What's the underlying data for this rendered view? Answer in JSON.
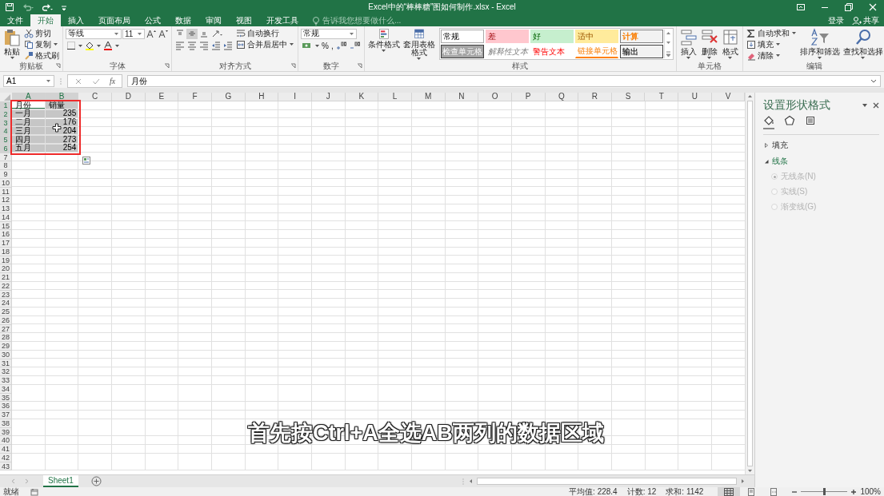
{
  "title_bar": {
    "title": "Excel中的“棒棒糖”图如何制作.xlsx - Excel",
    "sign_in": "登录",
    "share": "共享"
  },
  "ribbon_tabs": [
    {
      "label": "文件",
      "selected": false
    },
    {
      "label": "开始",
      "selected": true
    },
    {
      "label": "插入",
      "selected": false
    },
    {
      "label": "页面布局",
      "selected": false
    },
    {
      "label": "公式",
      "selected": false
    },
    {
      "label": "数据",
      "selected": false
    },
    {
      "label": "审阅",
      "selected": false
    },
    {
      "label": "视图",
      "selected": false
    },
    {
      "label": "开发工具",
      "selected": false
    }
  ],
  "tell_me": {
    "placeholder": "告诉我您想要做什么..."
  },
  "ribbon_groups": [
    {
      "kind": "clipboard",
      "label": "剪贴板",
      "launcher": true,
      "items": [
        "粘贴",
        "剪切",
        "复制",
        "格式刷"
      ]
    },
    {
      "kind": "font",
      "label": "字体",
      "launcher": true,
      "items": [
        "等线",
        "11"
      ]
    },
    {
      "kind": "alignment",
      "label": "对齐方式",
      "launcher": true,
      "items": [
        "自动换行",
        "合并后居中"
      ]
    },
    {
      "kind": "number",
      "label": "数字",
      "launcher": true,
      "items": [
        "常规",
        "%",
        ","
      ]
    },
    {
      "kind": "styles",
      "label": "样式",
      "launcher": false,
      "items": [
        "条件格式",
        "套用表格格式"
      ],
      "gallery": [
        {
          "label": "常规",
          "kind": "normal"
        },
        {
          "label": "差",
          "kind": "bad"
        },
        {
          "label": "好",
          "kind": "good"
        },
        {
          "label": "适中",
          "kind": "neutral"
        },
        {
          "label": "计算",
          "kind": "calc"
        },
        {
          "label": "检查单元格",
          "kind": "check"
        },
        {
          "label": "解释性文本",
          "kind": "explain"
        },
        {
          "label": "警告文本",
          "kind": "warn"
        },
        {
          "label": "链接单元格",
          "kind": "link"
        },
        {
          "label": "输出",
          "kind": "output"
        }
      ]
    },
    {
      "kind": "cells",
      "label": "单元格",
      "launcher": false,
      "items": [
        "插入",
        "删除",
        "格式"
      ]
    },
    {
      "kind": "editing",
      "label": "编辑",
      "launcher": false,
      "items": [
        "自动求和",
        "填充",
        "清除",
        "排序和筛选",
        "查找和选择"
      ]
    }
  ],
  "formula_bar": {
    "name_box": "A1",
    "function_button": "fx",
    "formula": "月份"
  },
  "sheet": {
    "columns": [
      {
        "label": "A",
        "selected": true
      },
      {
        "label": "B",
        "selected": true
      },
      {
        "label": "C",
        "selected": false
      },
      {
        "label": "D",
        "selected": false
      },
      {
        "label": "E",
        "selected": false
      },
      {
        "label": "F",
        "selected": false
      },
      {
        "label": "G",
        "selected": false
      },
      {
        "label": "H",
        "selected": false
      },
      {
        "label": "I",
        "selected": false
      },
      {
        "label": "J",
        "selected": false
      },
      {
        "label": "K",
        "selected": false
      },
      {
        "label": "L",
        "selected": false
      },
      {
        "label": "M",
        "selected": false
      },
      {
        "label": "N",
        "selected": false
      },
      {
        "label": "O",
        "selected": false
      },
      {
        "label": "P",
        "selected": false
      },
      {
        "label": "Q",
        "selected": false
      },
      {
        "label": "R",
        "selected": false
      },
      {
        "label": "S",
        "selected": false
      },
      {
        "label": "T",
        "selected": false
      },
      {
        "label": "U",
        "selected": false
      },
      {
        "label": "V",
        "selected": false
      }
    ],
    "row_headers": [
      {
        "label": "1",
        "selected": true
      },
      {
        "label": "2",
        "selected": true
      },
      {
        "label": "3",
        "selected": true
      },
      {
        "label": "4",
        "selected": true
      },
      {
        "label": "5",
        "selected": true
      },
      {
        "label": "6",
        "selected": true
      },
      {
        "label": "7",
        "selected": false
      },
      {
        "label": "8",
        "selected": false
      },
      {
        "label": "9",
        "selected": false
      },
      {
        "label": "10",
        "selected": false
      },
      {
        "label": "11",
        "selected": false
      },
      {
        "label": "12",
        "selected": false
      },
      {
        "label": "13",
        "selected": false
      },
      {
        "label": "14",
        "selected": false
      },
      {
        "label": "15",
        "selected": false
      },
      {
        "label": "16",
        "selected": false
      },
      {
        "label": "17",
        "selected": false
      },
      {
        "label": "18",
        "selected": false
      },
      {
        "label": "19",
        "selected": false
      },
      {
        "label": "20",
        "selected": false
      },
      {
        "label": "21",
        "selected": false
      },
      {
        "label": "22",
        "selected": false
      },
      {
        "label": "23",
        "selected": false
      },
      {
        "label": "24",
        "selected": false
      },
      {
        "label": "25",
        "selected": false
      },
      {
        "label": "26",
        "selected": false
      },
      {
        "label": "27",
        "selected": false
      },
      {
        "label": "28",
        "selected": false
      },
      {
        "label": "29",
        "selected": false
      },
      {
        "label": "30",
        "selected": false
      },
      {
        "label": "31",
        "selected": false
      },
      {
        "label": "32",
        "selected": false
      },
      {
        "label": "33",
        "selected": false
      },
      {
        "label": "34",
        "selected": false
      },
      {
        "label": "35",
        "selected": false
      },
      {
        "label": "36",
        "selected": false
      },
      {
        "label": "37",
        "selected": false
      },
      {
        "label": "38",
        "selected": false
      },
      {
        "label": "39",
        "selected": false
      },
      {
        "label": "40",
        "selected": false
      },
      {
        "label": "41",
        "selected": false
      },
      {
        "label": "42",
        "selected": false
      },
      {
        "label": "43",
        "selected": false
      }
    ],
    "rows": [
      [
        {
          "text": "月份",
          "kind": "text",
          "selected": true,
          "active": true
        },
        {
          "text": "销量",
          "kind": "text",
          "selected": true,
          "active": false
        }
      ],
      [
        {
          "text": "一月",
          "kind": "text",
          "selected": true,
          "active": false
        },
        {
          "text": "235",
          "kind": "number",
          "selected": true,
          "active": false
        }
      ],
      [
        {
          "text": "二月",
          "kind": "text",
          "selected": true,
          "active": false
        },
        {
          "text": "176",
          "kind": "number",
          "selected": true,
          "active": false
        }
      ],
      [
        {
          "text": "三月",
          "kind": "text",
          "selected": true,
          "active": false
        },
        {
          "text": "204",
          "kind": "number",
          "selected": true,
          "active": false
        }
      ],
      [
        {
          "text": "四月",
          "kind": "text",
          "selected": true,
          "active": false
        },
        {
          "text": "273",
          "kind": "number",
          "selected": true,
          "active": false
        }
      ],
      [
        {
          "text": "五月",
          "kind": "text",
          "selected": true,
          "active": false
        },
        {
          "text": "254",
          "kind": "number",
          "selected": true,
          "active": false
        }
      ]
    ]
  },
  "subtitle": "首先按Ctrl+A全选AB两列的数据区域",
  "sheet_tabs": [
    {
      "label": "Sheet1",
      "selected": true
    }
  ],
  "format_pane": {
    "title": "设置形状格式",
    "tabs": [
      {
        "selected": true
      },
      {
        "selected": false
      },
      {
        "selected": false
      }
    ],
    "sections": [
      {
        "label": "填充",
        "expanded": false
      },
      {
        "label": "线条",
        "expanded": true
      }
    ],
    "options": [
      {
        "label": "无线条(N)",
        "selected": true,
        "disabled": true
      },
      {
        "label": "实线(S)",
        "selected": false,
        "disabled": true
      },
      {
        "label": "渐变线(G)",
        "selected": false,
        "disabled": true
      }
    ]
  },
  "status_bar": {
    "status": "就绪",
    "stats": [
      "平均值: 228.4",
      "计数: 12",
      "求和: 1142"
    ],
    "views": [
      {
        "selected": true
      },
      {
        "selected": false
      },
      {
        "selected": false
      }
    ],
    "zoom": {
      "level": 0.5,
      "reading": "100%"
    }
  }
}
